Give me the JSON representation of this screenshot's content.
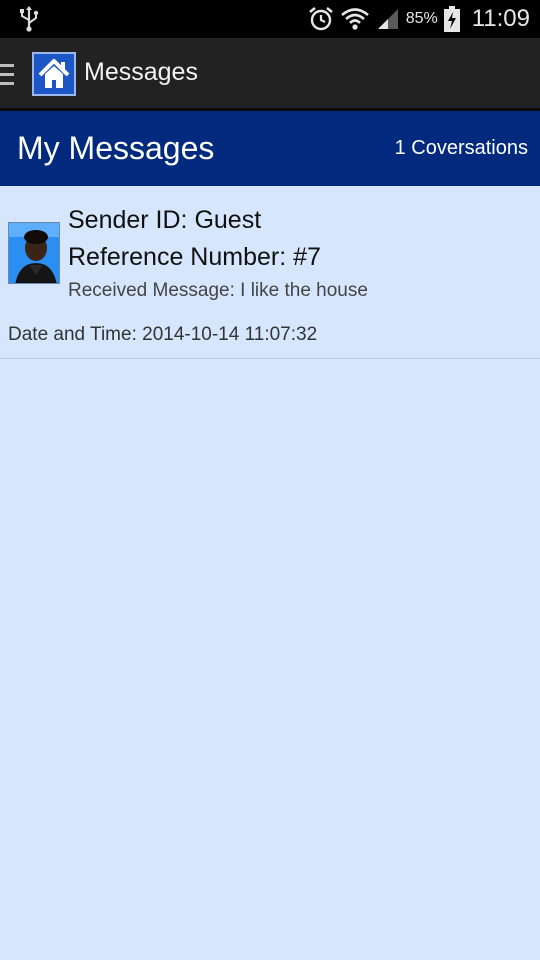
{
  "status_bar": {
    "battery_percent": "85%",
    "time": "11:09",
    "icons": [
      "usb-icon",
      "alarm-icon",
      "wifi-icon",
      "signal-icon",
      "battery-charging-icon"
    ]
  },
  "action_bar": {
    "title": "Messages",
    "icons": [
      "drawer-menu-icon",
      "home-icon"
    ]
  },
  "header": {
    "title": "My Messages",
    "conversation_count": "1 Coversations"
  },
  "messages": [
    {
      "sender": "Sender ID: Guest",
      "reference": "Reference Number: #7",
      "received": "Received Message: I like the house",
      "datetime": "Date and Time: 2014-10-14 11:07:32",
      "avatar_icon": "user-avatar"
    }
  ],
  "colors": {
    "background": "#d6e7fd",
    "header_band": "#012a7f",
    "action_bar": "#222222",
    "status_bar": "#000000"
  }
}
